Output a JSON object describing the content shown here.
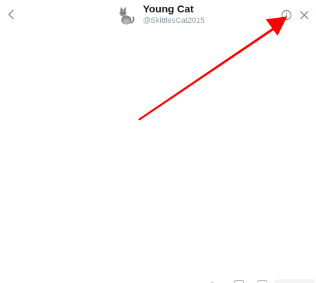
{
  "header": {
    "back_icon": "chevron-left-icon",
    "avatar_icon": "cat-avatar-icon",
    "title": "Young Cat",
    "handle": "@SkittlesCat2015",
    "info_icon": "info-circle-icon",
    "close_icon": "close-icon"
  },
  "annotation": {
    "arrow_color": "#ff0000",
    "arrow_target": "info-button"
  },
  "colors": {
    "background": "#ffffff",
    "title_text": "#14171a",
    "handle_text": "#8a9aa8",
    "icon": "#6b7b88"
  }
}
